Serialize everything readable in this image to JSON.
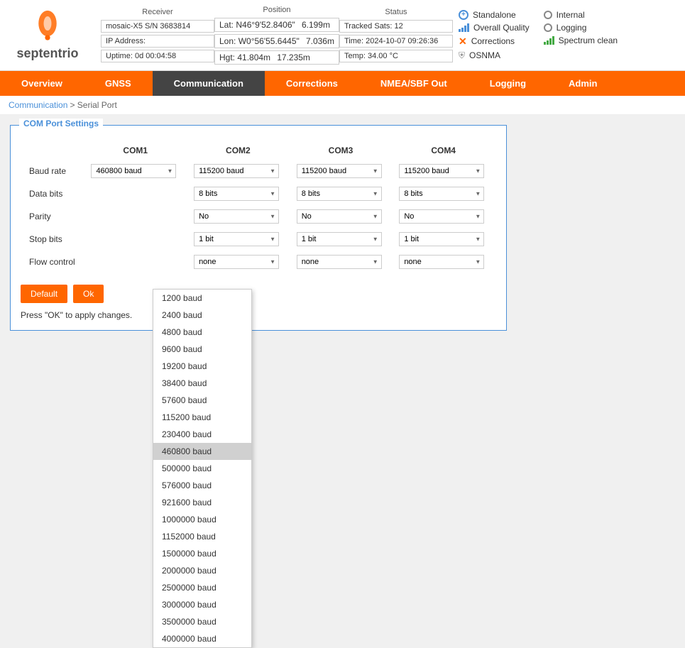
{
  "header": {
    "logo_text": "septentrio",
    "receiver": {
      "title": "Receiver",
      "fields": [
        {
          "label": "mosaic-X5 S/N 3683814"
        },
        {
          "label": "IP Address:"
        },
        {
          "label": "Uptime: 0d 00:04:58"
        }
      ]
    },
    "position": {
      "title": "Position",
      "fields": [
        {
          "label": "Lat: N46°9'52.8406\"",
          "value": "6.199m"
        },
        {
          "label": "Lon: W0°56'55.6445\"",
          "value": "7.036m"
        },
        {
          "label": "Hgt: 41.804m",
          "value": "17.235m"
        }
      ]
    },
    "status": {
      "title": "Status",
      "fields": [
        {
          "label": "Tracked Sats: 12"
        },
        {
          "label": "Time: 2024-10-07 09:26:36"
        },
        {
          "label": "Temp: 34.00 °C"
        }
      ]
    },
    "indicators": {
      "col1": [
        {
          "icon": "plus-circle",
          "label": "Standalone"
        },
        {
          "icon": "signal-bar",
          "label": "Overall Quality"
        },
        {
          "icon": "x-cross",
          "label": "Corrections"
        },
        {
          "icon": "shield",
          "label": "OSNMA"
        }
      ],
      "col2": [
        {
          "icon": "circle-gray",
          "label": "Internal"
        },
        {
          "icon": "circle-gray",
          "label": "Logging"
        },
        {
          "icon": "signal-green",
          "label": "Spectrum clean"
        }
      ]
    }
  },
  "nav": {
    "items": [
      {
        "label": "Overview",
        "active": false
      },
      {
        "label": "GNSS",
        "active": false
      },
      {
        "label": "Communication",
        "active": true
      },
      {
        "label": "Corrections",
        "active": false
      },
      {
        "label": "NMEA/SBF Out",
        "active": false
      },
      {
        "label": "Logging",
        "active": false
      },
      {
        "label": "Admin",
        "active": false
      }
    ]
  },
  "breadcrumb": {
    "parent": "Communication",
    "current": "Serial Port"
  },
  "com_settings": {
    "title": "COM Port Settings",
    "columns": [
      "COM1",
      "COM2",
      "COM3",
      "COM4"
    ],
    "rows": [
      {
        "label": "Baud rate",
        "values": [
          "460800 baud",
          "115200 baud",
          "115200 baud",
          "115200 baud"
        ]
      },
      {
        "label": "Data bits",
        "values": [
          "",
          "8 bits",
          "8 bits",
          "8 bits"
        ]
      },
      {
        "label": "Parity",
        "values": [
          "",
          "No",
          "No",
          "No"
        ]
      },
      {
        "label": "Stop bits",
        "values": [
          "",
          "1 bit",
          "1 bit",
          "1 bit"
        ]
      },
      {
        "label": "Flow control",
        "values": [
          "",
          "none",
          "none",
          "none"
        ]
      }
    ],
    "buttons": {
      "default": "Default",
      "ok": "Ok"
    },
    "press_ok_text": "Press \"OK\" to apply changes."
  },
  "baud_dropdown": {
    "options": [
      "1200 baud",
      "2400 baud",
      "4800 baud",
      "9600 baud",
      "19200 baud",
      "38400 baud",
      "57600 baud",
      "115200 baud",
      "230400 baud",
      "460800 baud",
      "500000 baud",
      "576000 baud",
      "921600 baud",
      "1000000 baud",
      "1152000 baud",
      "1500000 baud",
      "2000000 baud",
      "2500000 baud",
      "3000000 baud",
      "3500000 baud",
      "4000000 baud"
    ],
    "selected": "460800 baud"
  }
}
